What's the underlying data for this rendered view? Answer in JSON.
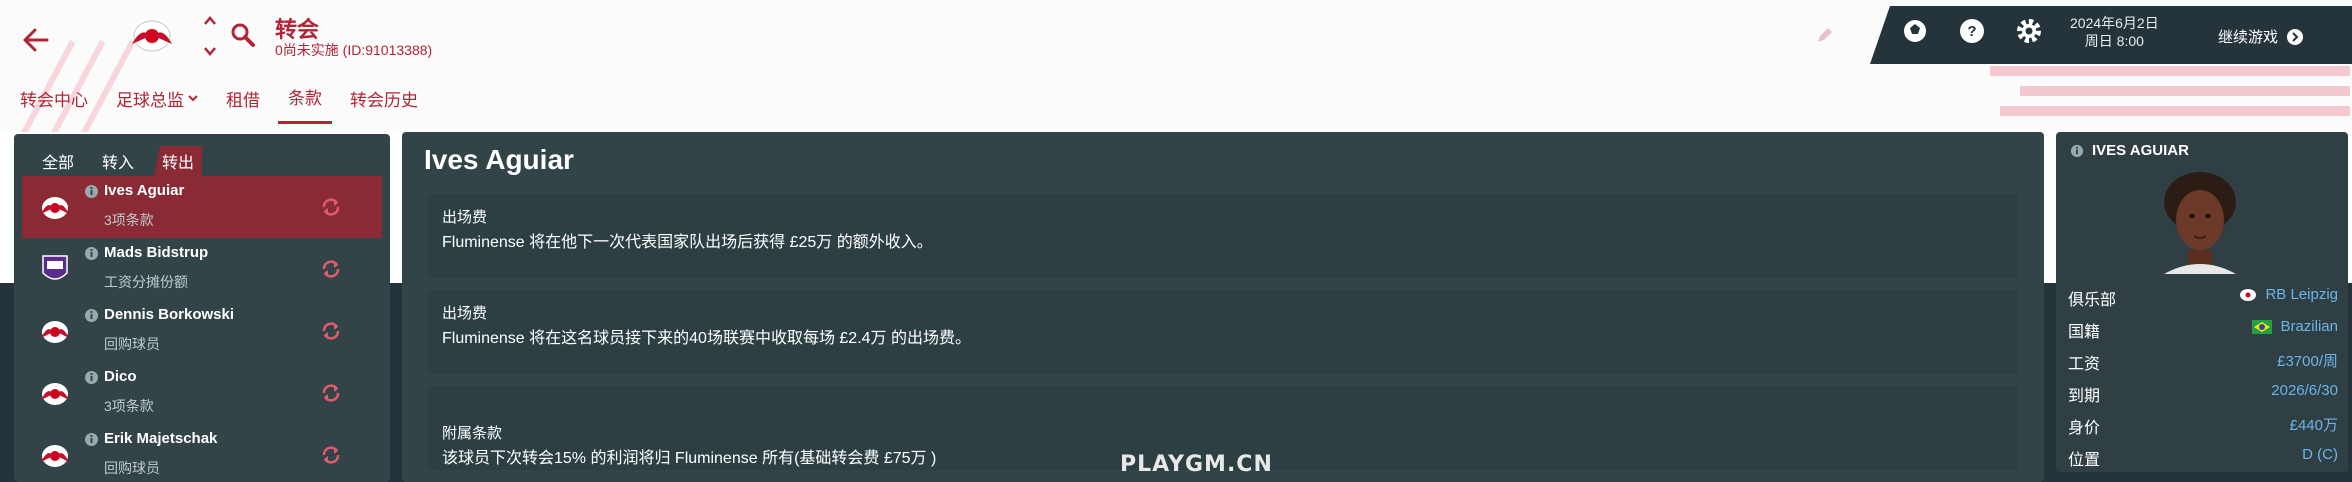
{
  "header": {
    "title": "转会",
    "subtitle": "0尚未实施 (ID:91013388)",
    "nav": [
      {
        "label": "转会中心"
      },
      {
        "label": "足球总监"
      },
      {
        "label": "租借"
      },
      {
        "label": "条款"
      },
      {
        "label": "转会历史"
      }
    ],
    "active_nav": "条款",
    "date_line1": "2024年6月2日",
    "date_line2": "周日 8:00",
    "continue_label": "继续游戏"
  },
  "left_panel": {
    "tabs": [
      {
        "label": "全部"
      },
      {
        "label": "转入"
      },
      {
        "label": "转出"
      }
    ],
    "active_tab": "转出",
    "players": [
      {
        "name": "Ives Aguiar",
        "sub": "3项条款",
        "club": "RB Leipzig"
      },
      {
        "name": "Mads Bidstrup",
        "sub": "工资分摊份额",
        "club": "Anderlecht"
      },
      {
        "name": "Dennis Borkowski",
        "sub": "回购球员",
        "club": "RB Leipzig"
      },
      {
        "name": "Dico",
        "sub": "3项条款",
        "club": "RB Leipzig"
      },
      {
        "name": "Erik Majetschak",
        "sub": "回购球员",
        "club": "RB Leipzig"
      }
    ]
  },
  "center_panel": {
    "title": "Ives Aguiar",
    "clauses": [
      {
        "label": "出场费",
        "text": "Fluminense 将在他下一次代表国家队出场后获得 £25万 的额外收入。"
      },
      {
        "label": "出场费",
        "text": "Fluminense 将在这名球员接下来的40场联赛中收取每场 £2.4万 的出场费。"
      },
      {
        "label": "附属条款",
        "text": "该球员下次转会15% 的利润将归 Fluminense 所有(基础转会费 £75万 )"
      }
    ]
  },
  "right_panel": {
    "player_name": "IVES AGUIAR",
    "rows": [
      {
        "key": "俱乐部",
        "value": "RB Leipzig"
      },
      {
        "key": "国籍",
        "value": "Brazilian"
      },
      {
        "key": "工资",
        "value": "£3700/周"
      },
      {
        "key": "到期",
        "value": "2026/6/30"
      },
      {
        "key": "身价",
        "value": "£440万"
      },
      {
        "key": "位置",
        "value": "D (C)"
      }
    ]
  },
  "watermark": "PLAYGM.CN",
  "colors": {
    "accent": "#b32436",
    "panel": "#334449",
    "selected": "#8a2a35",
    "link": "#6cb5e8"
  },
  "icons": [
    "back-arrow-icon",
    "club-crest-icon",
    "stepper-icon",
    "search-icon",
    "pencil-icon",
    "football-icon",
    "help-icon",
    "gear-icon",
    "chevron-right-icon",
    "info-icon",
    "refresh-icon",
    "flag-brazil-icon"
  ]
}
